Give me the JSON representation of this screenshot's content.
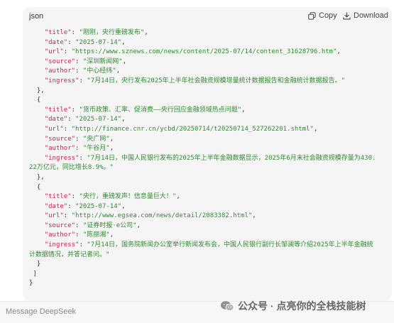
{
  "code_block": {
    "language": "json",
    "copy_label": "Copy",
    "download_label": "Download",
    "lines": [
      [
        {
          "c": "p",
          "t": "    "
        },
        {
          "c": "k",
          "t": "\"title\""
        },
        {
          "c": "p",
          "t": ": "
        },
        {
          "c": "s",
          "t": "\"刚刚，央行重磅发布\""
        },
        {
          "c": "p",
          "t": ","
        }
      ],
      [
        {
          "c": "p",
          "t": "    "
        },
        {
          "c": "k",
          "t": "\"date\""
        },
        {
          "c": "p",
          "t": ": "
        },
        {
          "c": "s",
          "t": "\"2025-07-14\""
        },
        {
          "c": "p",
          "t": ","
        }
      ],
      [
        {
          "c": "p",
          "t": "    "
        },
        {
          "c": "k",
          "t": "\"url\""
        },
        {
          "c": "p",
          "t": ": "
        },
        {
          "c": "s",
          "t": "\"https://www.sznews.com/news/content/2025-07/14/content_31628796.htm\""
        },
        {
          "c": "p",
          "t": ","
        }
      ],
      [
        {
          "c": "p",
          "t": "    "
        },
        {
          "c": "k",
          "t": "\"source\""
        },
        {
          "c": "p",
          "t": ": "
        },
        {
          "c": "s",
          "t": "\"深圳新闻网\""
        },
        {
          "c": "p",
          "t": ","
        }
      ],
      [
        {
          "c": "p",
          "t": "    "
        },
        {
          "c": "k",
          "t": "\"author\""
        },
        {
          "c": "p",
          "t": ": "
        },
        {
          "c": "s",
          "t": "\"中心经纬\""
        },
        {
          "c": "p",
          "t": ","
        }
      ],
      [
        {
          "c": "p",
          "t": "    "
        },
        {
          "c": "k",
          "t": "\"ingress\""
        },
        {
          "c": "p",
          "t": ": "
        },
        {
          "c": "s",
          "t": "\"7月14日，央行发布2025年上半年社会融资规模增量统计数据报告和金融统计数据报告。\""
        }
      ],
      [
        {
          "c": "p",
          "t": "  },"
        }
      ],
      [
        {
          "c": "p",
          "t": "  {"
        }
      ],
      [
        {
          "c": "p",
          "t": "    "
        },
        {
          "c": "k",
          "t": "\"title\""
        },
        {
          "c": "p",
          "t": ": "
        },
        {
          "c": "s",
          "t": "\"货币政策、汇率、促消费——央行回应金融领域热点问题\""
        },
        {
          "c": "p",
          "t": ","
        }
      ],
      [
        {
          "c": "p",
          "t": "    "
        },
        {
          "c": "k",
          "t": "\"date\""
        },
        {
          "c": "p",
          "t": ": "
        },
        {
          "c": "s",
          "t": "\"2025-07-14\""
        },
        {
          "c": "p",
          "t": ","
        }
      ],
      [
        {
          "c": "p",
          "t": "    "
        },
        {
          "c": "k",
          "t": "\"url\""
        },
        {
          "c": "p",
          "t": ": "
        },
        {
          "c": "s",
          "t": "\"http://finance.cnr.cn/ycbd/20250714/t20250714_527262201.shtml\""
        },
        {
          "c": "p",
          "t": ","
        }
      ],
      [
        {
          "c": "p",
          "t": "    "
        },
        {
          "c": "k",
          "t": "\"source\""
        },
        {
          "c": "p",
          "t": ": "
        },
        {
          "c": "s",
          "t": "\"央广网\""
        },
        {
          "c": "p",
          "t": ","
        }
      ],
      [
        {
          "c": "p",
          "t": "    "
        },
        {
          "c": "k",
          "t": "\"author\""
        },
        {
          "c": "p",
          "t": ": "
        },
        {
          "c": "s",
          "t": "\"牛谷月\""
        },
        {
          "c": "p",
          "t": ","
        }
      ],
      [
        {
          "c": "p",
          "t": "    "
        },
        {
          "c": "k",
          "t": "\"ingress\""
        },
        {
          "c": "p",
          "t": ": "
        },
        {
          "c": "s",
          "t": "\"7月14日，中国人民银行发布的2025年上半年金融数据显示，2025年6月末社会融资规模存量为430."
        }
      ],
      [
        {
          "c": "s",
          "t": "22万亿元，同比增长8.9%。\""
        }
      ],
      [
        {
          "c": "p",
          "t": "  },"
        }
      ],
      [
        {
          "c": "p",
          "t": "  {"
        }
      ],
      [
        {
          "c": "p",
          "t": "    "
        },
        {
          "c": "k",
          "t": "\"title\""
        },
        {
          "c": "p",
          "t": ": "
        },
        {
          "c": "s",
          "t": "\"央行，重磅发声！信息量巨大！\""
        },
        {
          "c": "p",
          "t": ","
        }
      ],
      [
        {
          "c": "p",
          "t": "    "
        },
        {
          "c": "k",
          "t": "\"date\""
        },
        {
          "c": "p",
          "t": ": "
        },
        {
          "c": "s",
          "t": "\"2025-07-14\""
        },
        {
          "c": "p",
          "t": ","
        }
      ],
      [
        {
          "c": "p",
          "t": "    "
        },
        {
          "c": "k",
          "t": "\"url\""
        },
        {
          "c": "p",
          "t": ": "
        },
        {
          "c": "s",
          "t": "\"http://www.egsea.com/news/detail/2083382.html\""
        },
        {
          "c": "p",
          "t": ","
        }
      ],
      [
        {
          "c": "p",
          "t": "    "
        },
        {
          "c": "k",
          "t": "\"source\""
        },
        {
          "c": "p",
          "t": ": "
        },
        {
          "c": "s",
          "t": "\"证券时报·e公司\""
        },
        {
          "c": "p",
          "t": ","
        }
      ],
      [
        {
          "c": "p",
          "t": "    "
        },
        {
          "c": "k",
          "t": "\"author\""
        },
        {
          "c": "p",
          "t": ": "
        },
        {
          "c": "s",
          "t": "\"陈丽湘\""
        },
        {
          "c": "p",
          "t": ","
        }
      ],
      [
        {
          "c": "p",
          "t": "    "
        },
        {
          "c": "k",
          "t": "\"ingress\""
        },
        {
          "c": "p",
          "t": ": "
        },
        {
          "c": "s",
          "t": "\"7月14日，国务院新闻办公室举行新闻发布会，中国人民银行副行长邹澜等介绍2025年上半年金融统"
        }
      ],
      [
        {
          "c": "s",
          "t": "计数据情况，并答记者问。\""
        }
      ],
      [
        {
          "c": "p",
          "t": "  }"
        }
      ],
      [
        {
          "c": "p",
          "t": " ]"
        }
      ],
      [
        {
          "c": "p",
          "t": "}"
        }
      ]
    ]
  },
  "composer": {
    "placeholder": "Message DeepSeek"
  },
  "watermark": {
    "text": "公众号 · 点亮你的全栈技能树"
  },
  "colors": {
    "key": "#c7254e",
    "string": "#2e8b2e",
    "punct": "#333333",
    "card_bg": "#f5f5f5"
  }
}
